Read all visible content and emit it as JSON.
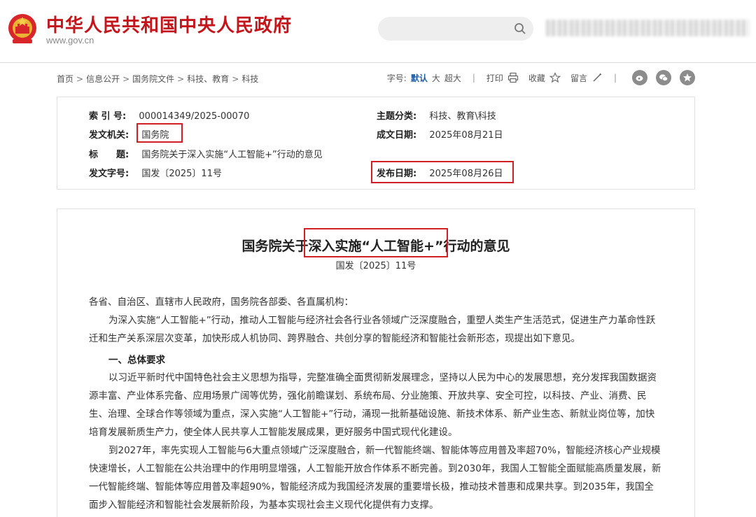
{
  "header": {
    "site_title": "中华人民共和国中央人民政府",
    "site_url": "www.gov.cn",
    "search_placeholder": "",
    "emblem_icon": "national-emblem-icon",
    "brand_color": "#c3161c"
  },
  "breadcrumb": [
    "首页",
    "信息公开",
    "国务院文件",
    "科技、教育",
    "科技"
  ],
  "toolbar": {
    "font_label": "字号:",
    "font_default": "默认",
    "font_large": "大",
    "font_xlarge": "超大",
    "print_label": "打印",
    "favorite_label": "收藏",
    "comment_label": "留言",
    "share_icons": [
      "weibo-icon",
      "wechat-icon",
      "star-icon"
    ]
  },
  "info": {
    "index_label": "索 引 号:",
    "index_value": "000014349/2025-00070",
    "issuer_label": "发文机关:",
    "issuer_value": "国务院",
    "title_label": "标　　题:",
    "title_value": "国务院关于深入实施“人工智能+”行动的意见",
    "docno_label": "发文字号:",
    "docno_value": "国发〔2025〕11号",
    "topic_label": "主题分类:",
    "topic_value": "科技、教育\\科技",
    "written_label": "成文日期:",
    "written_value": "2025年08月21日",
    "published_label": "发布日期:",
    "published_value": "2025年08月26日",
    "highlight_color": "#d21f26"
  },
  "article": {
    "title_prefix": "国务院关于",
    "title_highlight": "深入实施“人工智能+”",
    "title_suffix": "行动的意见",
    "doc_number": "国发〔2025〕11号",
    "salutation": "各省、自治区、直辖市人民政府，国务院各部委、各直属机构：",
    "intro": "为深入实施“人工智能+”行动，推动人工智能与经济社会各行业各领域广泛深度融合，重塑人类生产生活范式，促进生产力革命性跃迁和生产关系深层次变革，加快形成人机协同、跨界融合、共创分享的智能经济和智能社会新形态，现提出如下意见。",
    "section1": "一、总体要求",
    "para1": "以习近平新时代中国特色社会主义思想为指导，完整准确全面贯彻新发展理念，坚持以人民为中心的发展思想，充分发挥我国数据资源丰富、产业体系完备、应用场景广阔等优势，强化前瞻谋划、系统布局、分业施策、开放共享、安全可控，以科技、产业、消费、民生、治理、全球合作等领域为重点，深入实施“人工智能+”行动，涌现一批新基础设施、新技术体系、新产业生态、新就业岗位等，加快培育发展新质生产力，使全体人民共享人工智能发展成果，更好服务中国式现代化建设。",
    "para2": "到2027年，率先实现人工智能与6大重点领域广泛深度融合，新一代智能终端、智能体等应用普及率超70%，智能经济核心产业规模快速增长，人工智能在公共治理中的作用明显增强，人工智能开放合作体系不断完善。到2030年，我国人工智能全面赋能高质量发展，新一代智能终端、智能体等应用普及率超90%，智能经济成为我国经济发展的重要增长极，推动技术普惠和成果共享。到2035年，我国全面步入智能经济和智能社会发展新阶段，为基本实现社会主义现代化提供有力支撑。"
  }
}
